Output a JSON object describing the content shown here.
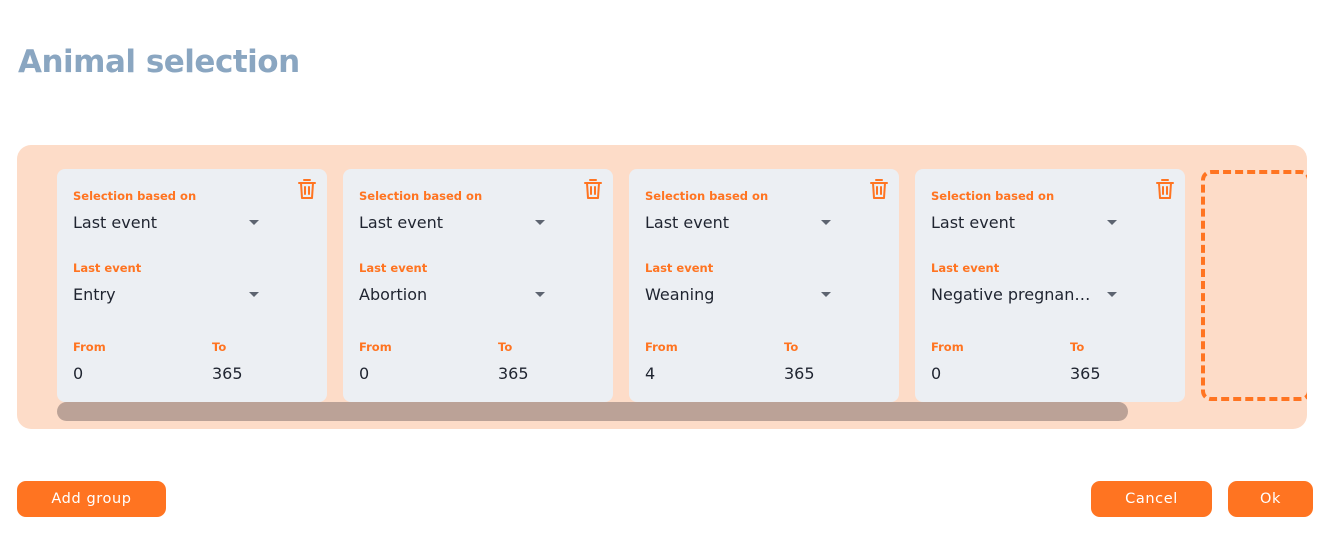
{
  "title": "Animal selection",
  "colors": {
    "accent": "#ff7421",
    "panel": "#fddcc8",
    "card": "#eceff3",
    "title": "#8aa6c1"
  },
  "groups": [
    {
      "selection_label": "Selection based on",
      "selection_value": "Last event",
      "event_label": "Last event",
      "event_value": "Entry",
      "from_label": "From",
      "from_value": "0",
      "to_label": "To",
      "to_value": "365",
      "delete_icon": "trash-icon"
    },
    {
      "selection_label": "Selection based on",
      "selection_value": "Last event",
      "event_label": "Last event",
      "event_value": "Abortion",
      "from_label": "From",
      "from_value": "0",
      "to_label": "To",
      "to_value": "365",
      "delete_icon": "trash-icon"
    },
    {
      "selection_label": "Selection based on",
      "selection_value": "Last event",
      "event_label": "Last event",
      "event_value": "Weaning",
      "from_label": "From",
      "from_value": "4",
      "to_label": "To",
      "to_value": "365",
      "delete_icon": "trash-icon"
    },
    {
      "selection_label": "Selection based on",
      "selection_value": "Last event",
      "event_label": "Last event",
      "event_value": "Negative pregnan…",
      "from_label": "From",
      "from_value": "0",
      "to_label": "To",
      "to_value": "365",
      "delete_icon": "trash-icon"
    }
  ],
  "buttons": {
    "add_group": "Add group",
    "cancel": "Cancel",
    "ok": "Ok"
  }
}
